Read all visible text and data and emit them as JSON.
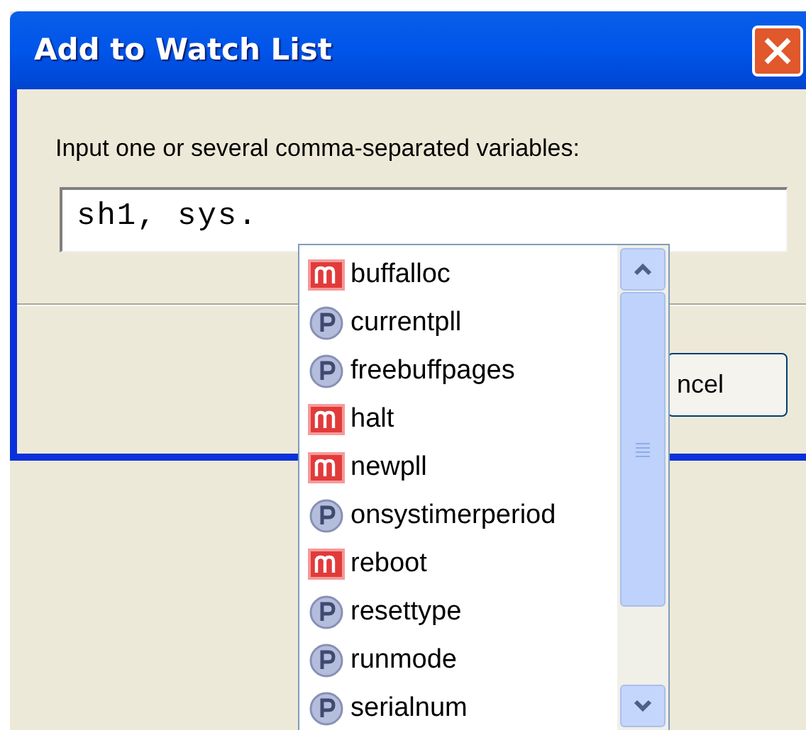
{
  "window": {
    "title": "Add to Watch List"
  },
  "prompt": "Input one or several comma-separated variables:",
  "input": {
    "value": "sh1, sys."
  },
  "buttons": [
    {
      "label": "ncel"
    }
  ],
  "completion_list": [
    {
      "label": "buffalloc",
      "kind": "method"
    },
    {
      "label": "currentpll",
      "kind": "property"
    },
    {
      "label": "freebuffpages",
      "kind": "property"
    },
    {
      "label": "halt",
      "kind": "method"
    },
    {
      "label": "newpll",
      "kind": "method"
    },
    {
      "label": "onsystimerperiod",
      "kind": "property"
    },
    {
      "label": "reboot",
      "kind": "method"
    },
    {
      "label": "resettype",
      "kind": "property"
    },
    {
      "label": "runmode",
      "kind": "property"
    },
    {
      "label": "serialnum",
      "kind": "property"
    }
  ]
}
